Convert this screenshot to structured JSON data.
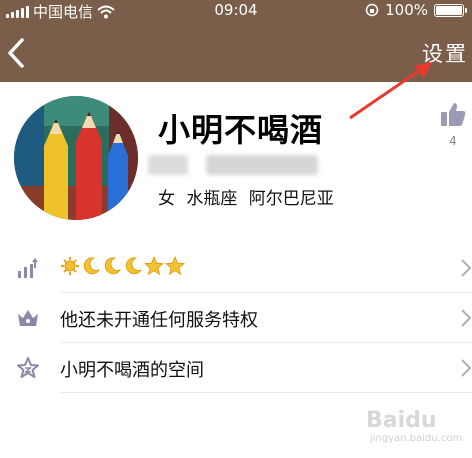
{
  "status_bar": {
    "carrier": "中国电信",
    "time": "09:04",
    "battery": "100%"
  },
  "nav": {
    "back_icon": "chevron-left-icon",
    "settings_label": "设置"
  },
  "profile": {
    "name": "小明不喝酒",
    "info": "女 水瓶座 阿尔巴尼亚",
    "like_count": "4"
  },
  "rows": [
    {
      "icon": "level-icon",
      "levels": [
        "sun",
        "moon",
        "moon",
        "moon",
        "star",
        "star"
      ]
    },
    {
      "icon": "crown-icon",
      "label": "他还未开通任何服务特权"
    },
    {
      "icon": "star-space-icon",
      "label": "小明不喝酒的空间"
    }
  ],
  "watermark": {
    "brand": "Baidu",
    "sub": "jingyan.baidu.com"
  },
  "colors": {
    "header": "#7a5e4a",
    "annotation_arrow": "#e83a2e",
    "icon_gray": "#8a8aa8",
    "level_gold": "#f2c230"
  }
}
